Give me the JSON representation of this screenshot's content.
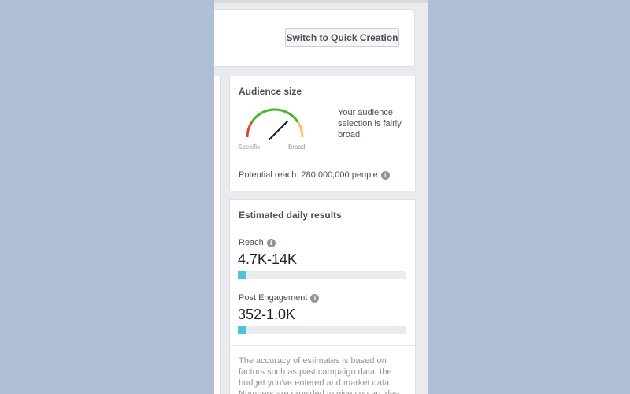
{
  "header": {
    "switch_button_label": "Switch to Quick Creation"
  },
  "audience_size": {
    "title": "Audience size",
    "gauge": {
      "left_label": "Specific",
      "right_label": "Broad"
    },
    "description": "Your audience selection is fairly broad.",
    "potential_reach": "Potential reach: 280,000,000 people"
  },
  "estimated_daily_results": {
    "title": "Estimated daily results",
    "metrics": [
      {
        "label": "Reach",
        "value": "4.7K-14K",
        "bar_fraction": 0.05
      },
      {
        "label": "Post Engagement",
        "value": "352-1.0K",
        "bar_fraction": 0.05
      }
    ],
    "note": "The accuracy of estimates is based on factors such as past campaign data, the budget you've entered and market data. Numbers are provided to give you an idea of"
  },
  "colors": {
    "gauge_green": "#42b72a",
    "gauge_red": "#d64838",
    "gauge_orange": "#f5c26b",
    "bar_fill": "#4ec3e0"
  },
  "icons": {
    "info": "info-icon"
  }
}
